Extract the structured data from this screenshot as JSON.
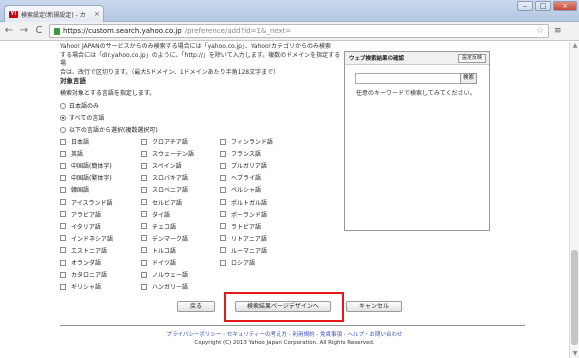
{
  "browser": {
    "tab_title": "検索設定(新規設定) - カ",
    "tab_close": "×",
    "favicon_text": "Y!",
    "url_host": "https://custom.search.yahoo.co.jp",
    "url_path": "/preference/add?id=1&_next=",
    "nav_back": "←",
    "nav_forward": "→",
    "nav_reload": "C",
    "nav_home": "⌂",
    "star": "☆",
    "menu": "≡",
    "win_min": "–",
    "win_max": "□",
    "win_close": "×"
  },
  "intro": {
    "line1": "Yahoo! JAPANのサービスからのみ検索する場合には「yahoo.co.jp」、Yahoo!カテゴリからのみ検索",
    "line2": "する場合には「dir.yahoo.co.jp」のように、「http://」を除いて入力します。複数のドメインを指定する場",
    "line3": "合は、改行で区切ります。（最大5ドメイン、1ドメインあたり半角128文字まで）"
  },
  "language": {
    "heading": "対象言語",
    "desc": "検索対象とする言語を指定します。",
    "radios": [
      {
        "label": "日本語のみ",
        "checked": false
      },
      {
        "label": "すべての言語",
        "checked": true
      },
      {
        "label": "以下の言語から選択(複数選択可)",
        "checked": false
      }
    ],
    "col1": [
      "日本語",
      "英語",
      "中国語(簡体字)",
      "中国語(繁体字)",
      "韓国語",
      "アイスランド語",
      "アラビア語",
      "イタリア語",
      "インドネシア語",
      "エストニア語",
      "オランダ語",
      "カタロニア語",
      "ギリシャ語"
    ],
    "col2": [
      "クロアチア語",
      "スウェーデン語",
      "スペイン語",
      "スロバキア語",
      "スロベニア語",
      "セルビア語",
      "タイ語",
      "チェコ語",
      "デンマーク語",
      "トルコ語",
      "ドイツ語",
      "ノルウェー語",
      "ハンガリー語"
    ],
    "col3": [
      "フィンランド語",
      "フランス語",
      "ブルガリア語",
      "ヘブライ語",
      "ペルシャ語",
      "ポルトガル語",
      "ポーランド語",
      "ラトビア語",
      "リトアニア語",
      "ルーマニア語",
      "ロシア語"
    ]
  },
  "preview_panel": {
    "title": "ウェブ検索結果の確認",
    "reset_label": "設定反映",
    "search_button": "検索",
    "search_value": "",
    "hint": "任意のキーワードで検索してみてください。"
  },
  "buttons": {
    "back": "戻る",
    "design": "検索結果ページデザインへ",
    "cancel": "キャンセル"
  },
  "footer": {
    "links": [
      "プライバシーポリシー",
      "セキュリティーの考え方",
      "利用規約",
      "免責事項",
      "ヘルプ・お問い合わせ"
    ],
    "separator": " - ",
    "copyright": "Copyright (C) 2013 Yahoo Japan Corporation. All Rights Reserved."
  },
  "colors": {
    "highlight": "#e51b1b",
    "link": "#3b4fb0"
  }
}
